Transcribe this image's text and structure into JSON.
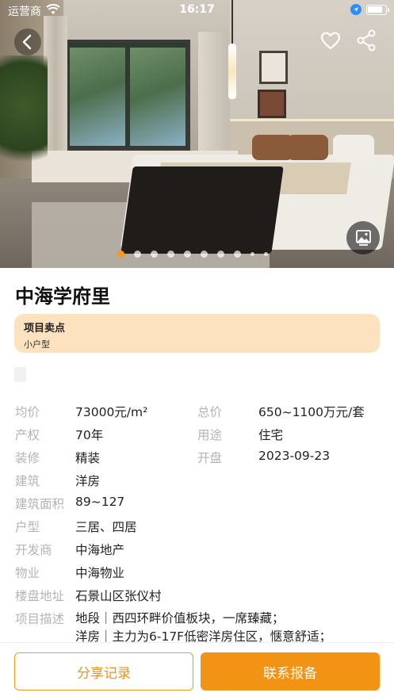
{
  "status_bar": {
    "carrier": "运营商",
    "time": "16:17"
  },
  "project": {
    "name": "中海学府里",
    "selling_points": {
      "title": "项目卖点",
      "text": "小户型"
    }
  },
  "gallery": {
    "dot_count": 10,
    "active_index": 0
  },
  "details": [
    {
      "label": "均价",
      "value": "73000元/m²",
      "label2": "总价",
      "value2": "650~1100万元/套"
    },
    {
      "label": "产权",
      "value": "70年",
      "label2": "用途",
      "value2": "住宅"
    },
    {
      "label": "装修",
      "value": "精装",
      "label2": "开盘",
      "value2": "2023-09-23"
    },
    {
      "label": "建筑",
      "value": "洋房"
    },
    {
      "label": "建筑面积",
      "value": "89~127"
    },
    {
      "label": "户型",
      "value": "三居、四居"
    },
    {
      "label": "开发商",
      "value": "中海地产"
    },
    {
      "label": "物业",
      "value": "中海物业"
    },
    {
      "label": "楼盘地址",
      "value": "石景山区张仪村"
    }
  ],
  "description": {
    "label": "项目描述",
    "lines": [
      "地段｜西四环畔价值板块，一席臻藏；",
      "洋房｜主力为6-17F低密洋房住区，惬意舒适；"
    ]
  },
  "actions": {
    "share_label": "分享记录",
    "contact_label": "联系报备"
  },
  "colors": {
    "accent": "#f39315",
    "selling_bg": "#fde2bf"
  },
  "icons": [
    "back-icon",
    "heart-icon",
    "share-icon",
    "gallery-icon",
    "wifi-icon",
    "location-icon",
    "battery-icon"
  ]
}
